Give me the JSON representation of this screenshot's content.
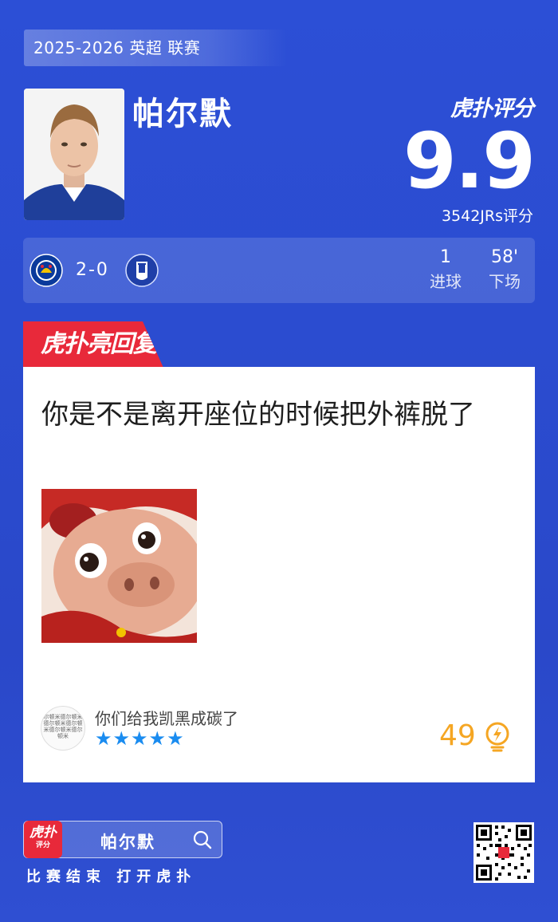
{
  "header": {
    "season": "2025-2026 英超 联赛",
    "player_name": "帕尔默",
    "brand": "虎扑评分",
    "score": "9.9",
    "rating_count": "3542JRs评分"
  },
  "match": {
    "home_team": "Chelsea",
    "away_team": "Everton",
    "score": "2-0",
    "stats": [
      {
        "value": "1",
        "label": "进球"
      },
      {
        "value": "58'",
        "label": "下场"
      }
    ]
  },
  "comment": {
    "tag": "虎扑亮回复",
    "text": "你是不是离开座位的时候把外裤脱了",
    "user_name": "你们给我凯黑成碳了",
    "avatar_text": "尔顿米德尔顿米德尔顿米德尔顿米德尔顿米德尔顿米",
    "stars": "★★★★★",
    "star_rating": 5,
    "light_count": "49"
  },
  "footer": {
    "app_label": "虎扑",
    "app_sub": "评分",
    "search_name": "帕尔默",
    "cta": "比赛结束 打开虎扑"
  },
  "colors": {
    "background": "#2b4cd0",
    "accent_red": "#e8293a",
    "star_blue": "#1a8cf0",
    "light_orange": "#f5a623"
  }
}
